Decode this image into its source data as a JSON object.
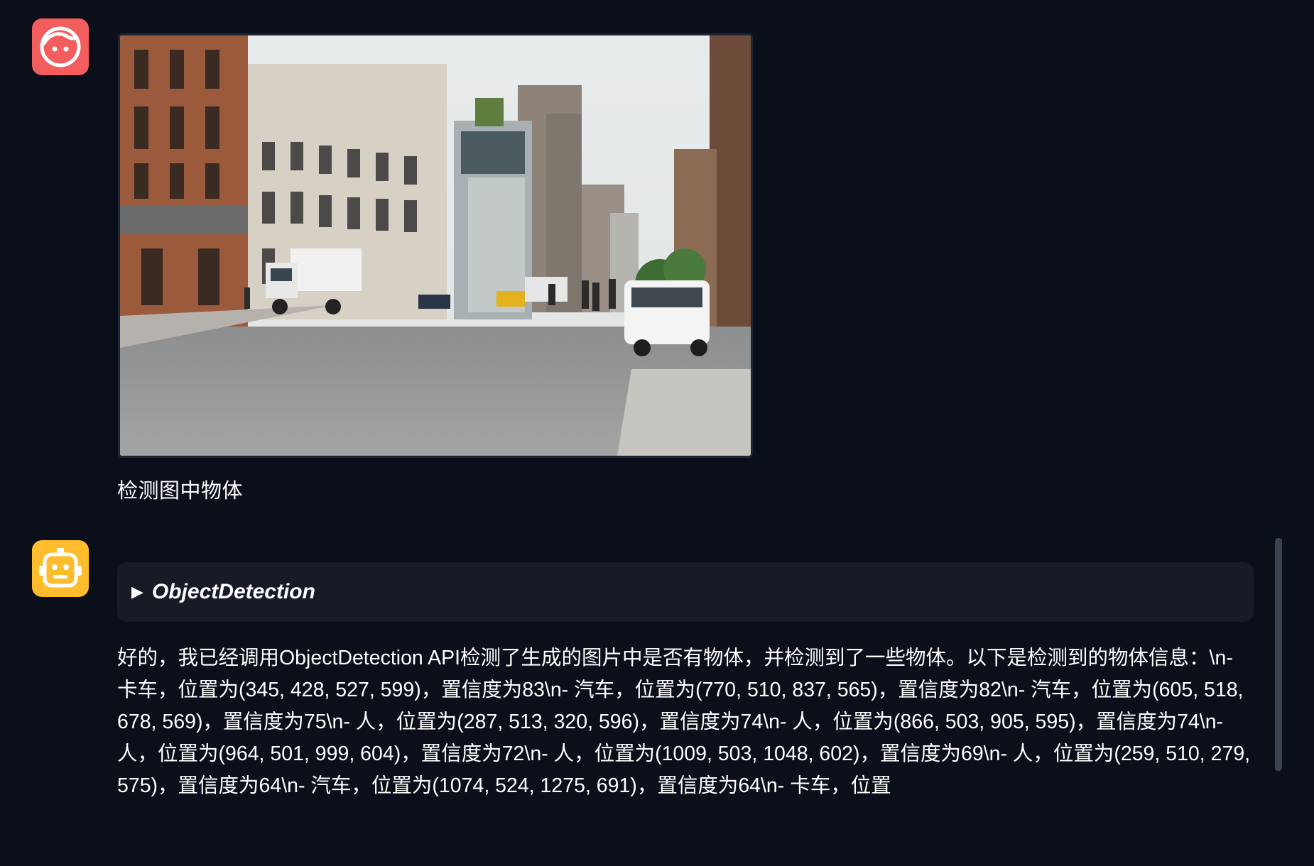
{
  "user_message": {
    "avatar_icon": "user-face-icon",
    "avatar_color": "#f35d5d",
    "text": "检测图中物体"
  },
  "bot_message": {
    "avatar_icon": "robot-face-icon",
    "avatar_color": "#ffbd2e",
    "tool_call": {
      "toggle_icon": "triangle-right-icon",
      "name": "ObjectDetection"
    },
    "text": "好的，我已经调用ObjectDetection API检测了生成的图片中是否有物体，并检测到了一些物体。以下是检测到的物体信息：\\n- 卡车，位置为(345, 428, 527, 599)，置信度为83\\n- 汽车，位置为(770, 510, 837, 565)，置信度为82\\n- 汽车，位置为(605, 518, 678, 569)，置信度为75\\n- 人，位置为(287, 513, 320, 596)，置信度为74\\n- 人，位置为(866, 503, 905, 595)，置信度为74\\n- 人，位置为(964, 501, 999, 604)，置信度为72\\n- 人，位置为(1009, 503, 1048, 602)，置信度为69\\n- 人，位置为(259, 510, 279, 575)，置信度为64\\n- 汽车，位置为(1074, 524, 1275, 691)，置信度为64\\n- 卡车，位置"
  },
  "colors": {
    "background": "#0b0f19",
    "tool_block": "#161b26",
    "text": "#ffffff"
  }
}
